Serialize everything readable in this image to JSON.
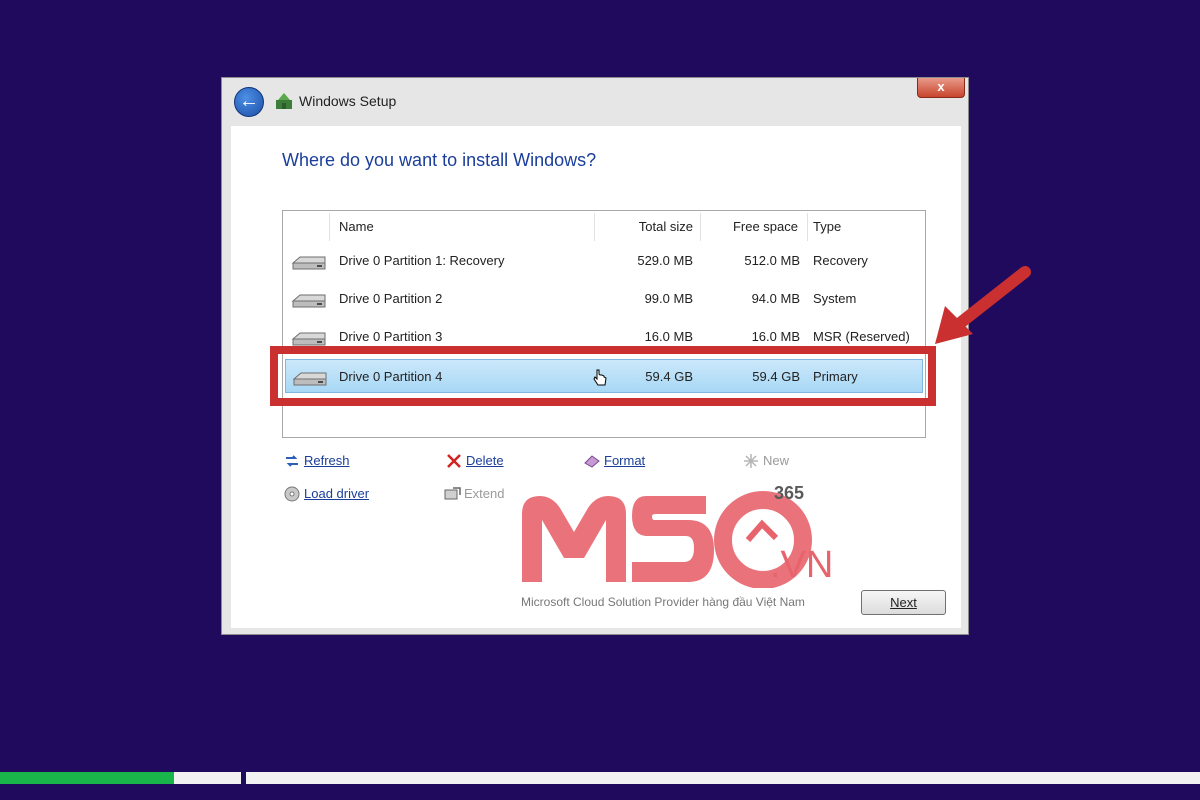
{
  "window": {
    "title": "Windows Setup",
    "close_label": "x",
    "heading": "Where do you want to install Windows?"
  },
  "table": {
    "columns": {
      "name": "Name",
      "total": "Total size",
      "free": "Free space",
      "type": "Type"
    },
    "rows": [
      {
        "name": "Drive 0 Partition 1: Recovery",
        "total": "529.0 MB",
        "free": "512.0 MB",
        "type": "Recovery"
      },
      {
        "name": "Drive 0 Partition 2",
        "total": "99.0 MB",
        "free": "94.0 MB",
        "type": "System"
      },
      {
        "name": "Drive 0 Partition 3",
        "total": "16.0 MB",
        "free": "16.0 MB",
        "type": "MSR (Reserved)"
      },
      {
        "name": "Drive 0 Partition 4",
        "total": "59.4 GB",
        "free": "59.4 GB",
        "type": "Primary",
        "selected": true
      }
    ]
  },
  "actions": {
    "refresh": "Refresh",
    "delete": "Delete",
    "format": "Format",
    "new": "New",
    "load_driver": "Load driver",
    "extend": "Extend"
  },
  "buttons": {
    "next": "Next"
  },
  "watermark": {
    "badge": "365",
    "suffix": ".VN",
    "tagline": "Microsoft Cloud Solution Provider hàng đầu Việt Nam"
  },
  "progress": {
    "value": 0.145
  },
  "colors": {
    "background": "#1f0a5e",
    "heading": "#1a3e9a",
    "highlight": "#c9302f",
    "selected_row": "#a8d8f5",
    "progress": "#19b54a",
    "watermark": "#e8646d"
  }
}
